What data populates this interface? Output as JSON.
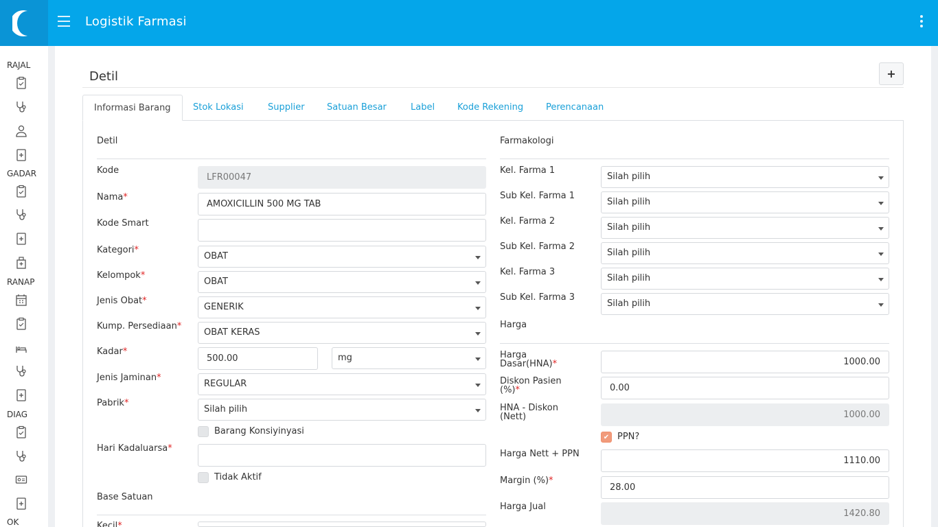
{
  "app": {
    "title": "Logistik Farmasi"
  },
  "colors": {
    "topbar": "#04a6ea",
    "accent": "#1aa0d8",
    "required": "#e02424",
    "checkbox_on": "#f19b7c"
  },
  "sidebar": {
    "groups": [
      {
        "label": "RAJAL",
        "icons": [
          "clipboard-icon",
          "stethoscope-icon",
          "doctor-icon",
          "medical-file-icon"
        ]
      },
      {
        "label": "GADAR",
        "icons": [
          "clipboard-icon",
          "stethoscope-icon",
          "medical-file-icon",
          "hospital-icon"
        ]
      },
      {
        "label": "RANAP",
        "icons": [
          "calendar-icon",
          "clipboard-icon",
          "bed-icon",
          "stethoscope-icon",
          "medical-file-icon"
        ]
      },
      {
        "label": "DIAG",
        "icons": [
          "clipboard-icon",
          "stethoscope-icon",
          "id-card-icon",
          "medical-file-icon"
        ]
      },
      {
        "label": "OK",
        "icons": []
      }
    ]
  },
  "page": {
    "title": "Detil",
    "add_button": "+"
  },
  "tabs": [
    {
      "label": "Informasi Barang",
      "active": true
    },
    {
      "label": "Stok Lokasi",
      "active": false
    },
    {
      "label": "Supplier",
      "active": false
    },
    {
      "label": "Satuan Besar",
      "active": false
    },
    {
      "label": "Label",
      "active": false
    },
    {
      "label": "Kode Rekening",
      "active": false
    },
    {
      "label": "Perencanaan",
      "active": false
    }
  ],
  "left": {
    "section_detil": "Detil",
    "kode": {
      "label": "Kode",
      "value": "LFR00047"
    },
    "nama": {
      "label": "Nama",
      "value": "AMOXICILLIN 500 MG TAB"
    },
    "kode_smart": {
      "label": "Kode Smart",
      "value": ""
    },
    "kategori": {
      "label": "Kategori",
      "value": "OBAT"
    },
    "kelompok": {
      "label": "Kelompok",
      "value": "OBAT"
    },
    "jenis_obat": {
      "label": "Jenis Obat",
      "value": "GENERIK"
    },
    "kump_persediaan": {
      "label": "Kump. Persediaan",
      "value": "OBAT KERAS"
    },
    "kadar": {
      "label": "Kadar",
      "value": "500.00",
      "unit": "mg"
    },
    "jenis_jaminan": {
      "label": "Jenis Jaminan",
      "value": "REGULAR"
    },
    "pabrik": {
      "label": "Pabrik",
      "value": "Silah pilih"
    },
    "barang_konsinyasi": {
      "label": "Barang Konsiyinyasi",
      "checked": false
    },
    "hari_kadaluarsa": {
      "label": "Hari Kadaluarsa",
      "value": ""
    },
    "tidak_aktif": {
      "label": "Tidak Aktif",
      "checked": false
    },
    "section_base_satuan": "Base Satuan",
    "kecil": {
      "label": "Kecil"
    }
  },
  "right": {
    "section_farmakologi": "Farmakologi",
    "kel_farma_1": {
      "label": "Kel. Farma 1",
      "value": "Silah pilih"
    },
    "sub_kel_farma_1": {
      "label": "Sub Kel. Farma 1",
      "value": "Silah pilih"
    },
    "kel_farma_2": {
      "label": "Kel. Farma 2",
      "value": "Silah pilih"
    },
    "sub_kel_farma_2": {
      "label": "Sub Kel. Farma 2",
      "value": "Silah pilih"
    },
    "kel_farma_3": {
      "label": "Kel. Farma 3",
      "value": "Silah pilih"
    },
    "sub_kel_farma_3": {
      "label": "Sub Kel. Farma 3",
      "value": "Silah pilih"
    },
    "section_harga": "Harga",
    "harga_dasar": {
      "label_1": "Harga",
      "label_2": "Dasar(HNA)",
      "value": "1000.00"
    },
    "diskon_pasien": {
      "label_1": "Diskon Pasien",
      "label_2": "(%)",
      "value": "0.00"
    },
    "hna_diskon": {
      "label_1": "HNA - Diskon",
      "label_2": "(Nett)",
      "value": "1000.00"
    },
    "ppn": {
      "label": "PPN?",
      "checked": true
    },
    "harga_nett_ppn": {
      "label": "Harga Nett + PPN",
      "value": "1110.00"
    },
    "margin": {
      "label": "Margin (%)",
      "value": "28.00"
    },
    "harga_jual": {
      "label": "Harga Jual",
      "value": "1420.80"
    }
  }
}
